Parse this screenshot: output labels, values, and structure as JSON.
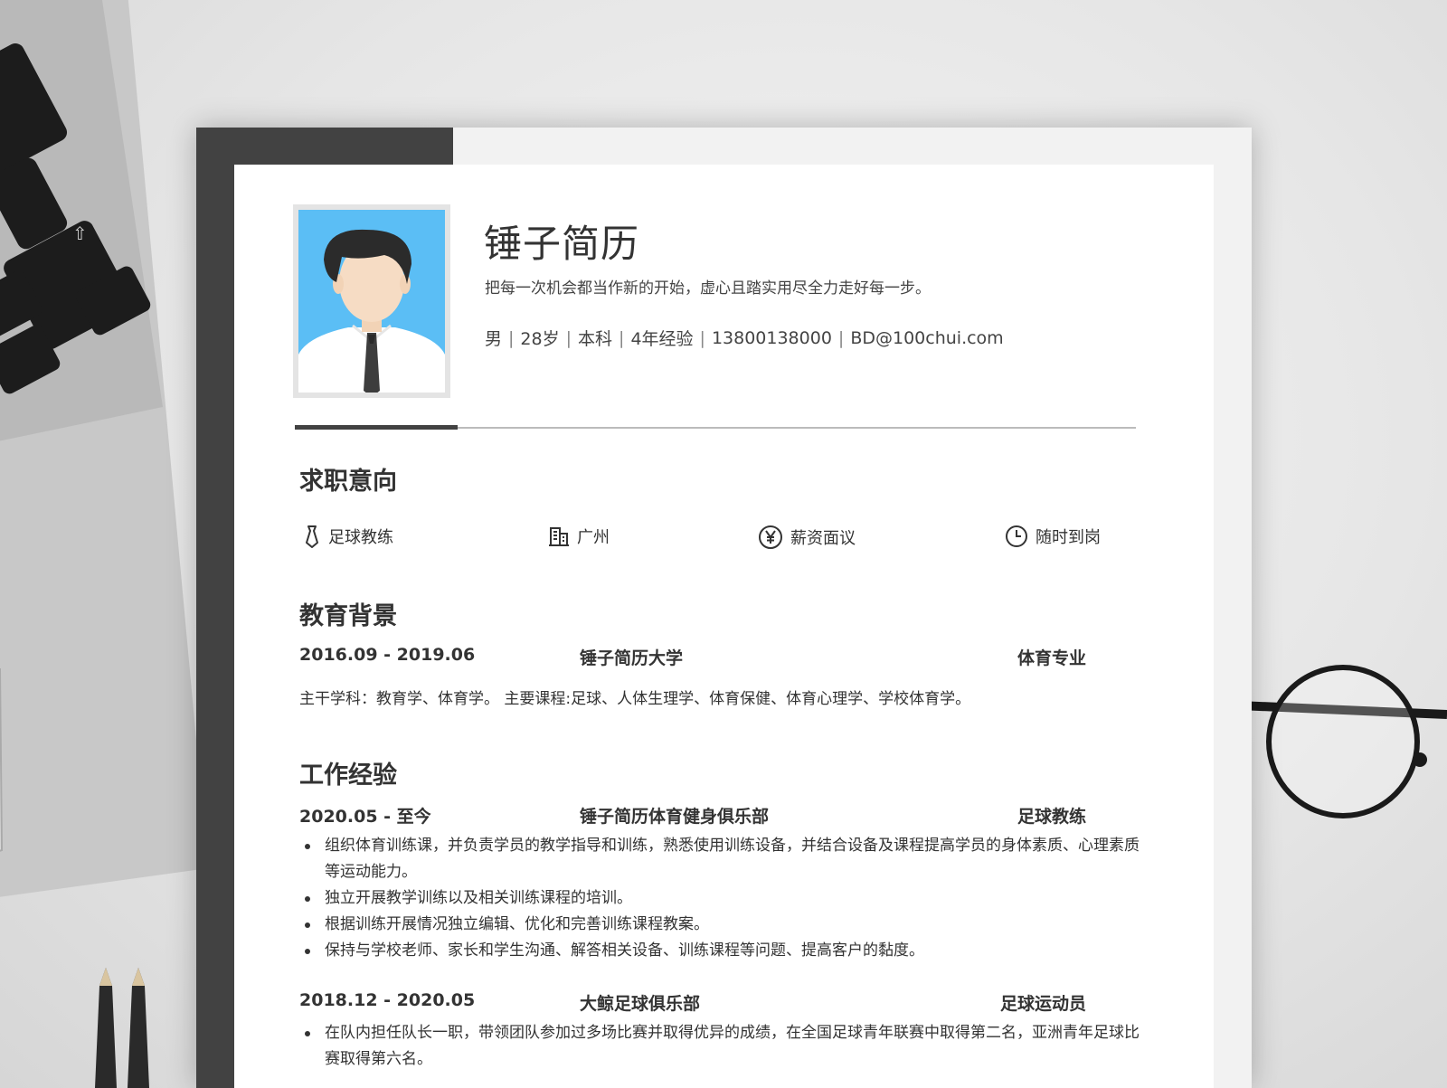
{
  "header": {
    "name": "锤子简历",
    "motto": "把每一次机会都当作新的开始，虚心且踏实用尽全力走好每一步。",
    "info": [
      "男",
      "28岁",
      "本科",
      "4年经验",
      "13800138000",
      "BD@100chui.com"
    ],
    "separator": "|"
  },
  "job_intent": {
    "title": "求职意向",
    "items": [
      {
        "icon": "tie-icon",
        "label": "足球教练"
      },
      {
        "icon": "building-icon",
        "label": "广州"
      },
      {
        "icon": "yen-icon",
        "label": "薪资面议"
      },
      {
        "icon": "clock-icon",
        "label": "随时到岗"
      }
    ]
  },
  "education": {
    "title": "教育背景",
    "period": "2016.09 - 2019.06",
    "school": "锤子简历大学",
    "major": "体育专业",
    "description": "主干学科：教育学、体育学。 主要课程:足球、人体生理学、体育保健、体育心理学、学校体育学。"
  },
  "work": {
    "title": "工作经验",
    "jobs": [
      {
        "period": "2020.05 - 至今",
        "company": "锤子简历体育健身俱乐部",
        "role": "足球教练",
        "bullets": [
          "组织体育训练课，并负责学员的教学指导和训练，熟悉使用训练设备，并结合设备及课程提高学员的身体素质、心理素质等运动能力。",
          "独立开展教学训练以及相关训练课程的培训。",
          "根据训练开展情况独立编辑、优化和完善训练课程教案。",
          "保持与学校老师、家长和学生沟通、解答相关设备、训练课程等问题、提高客户的黏度。"
        ]
      },
      {
        "period": "2018.12 - 2020.05",
        "company": "大鲸足球俱乐部",
        "role": "足球运动员",
        "bullets": [
          "在队内担任队长一职，带领团队参加过多场比赛并取得优异的成绩，在全国足球青年联赛中取得第二名，亚洲青年足球比赛取得第六名。"
        ]
      }
    ]
  },
  "colors": {
    "band": "#424242",
    "photo_bg": "#5bbef5",
    "text": "#333333"
  }
}
